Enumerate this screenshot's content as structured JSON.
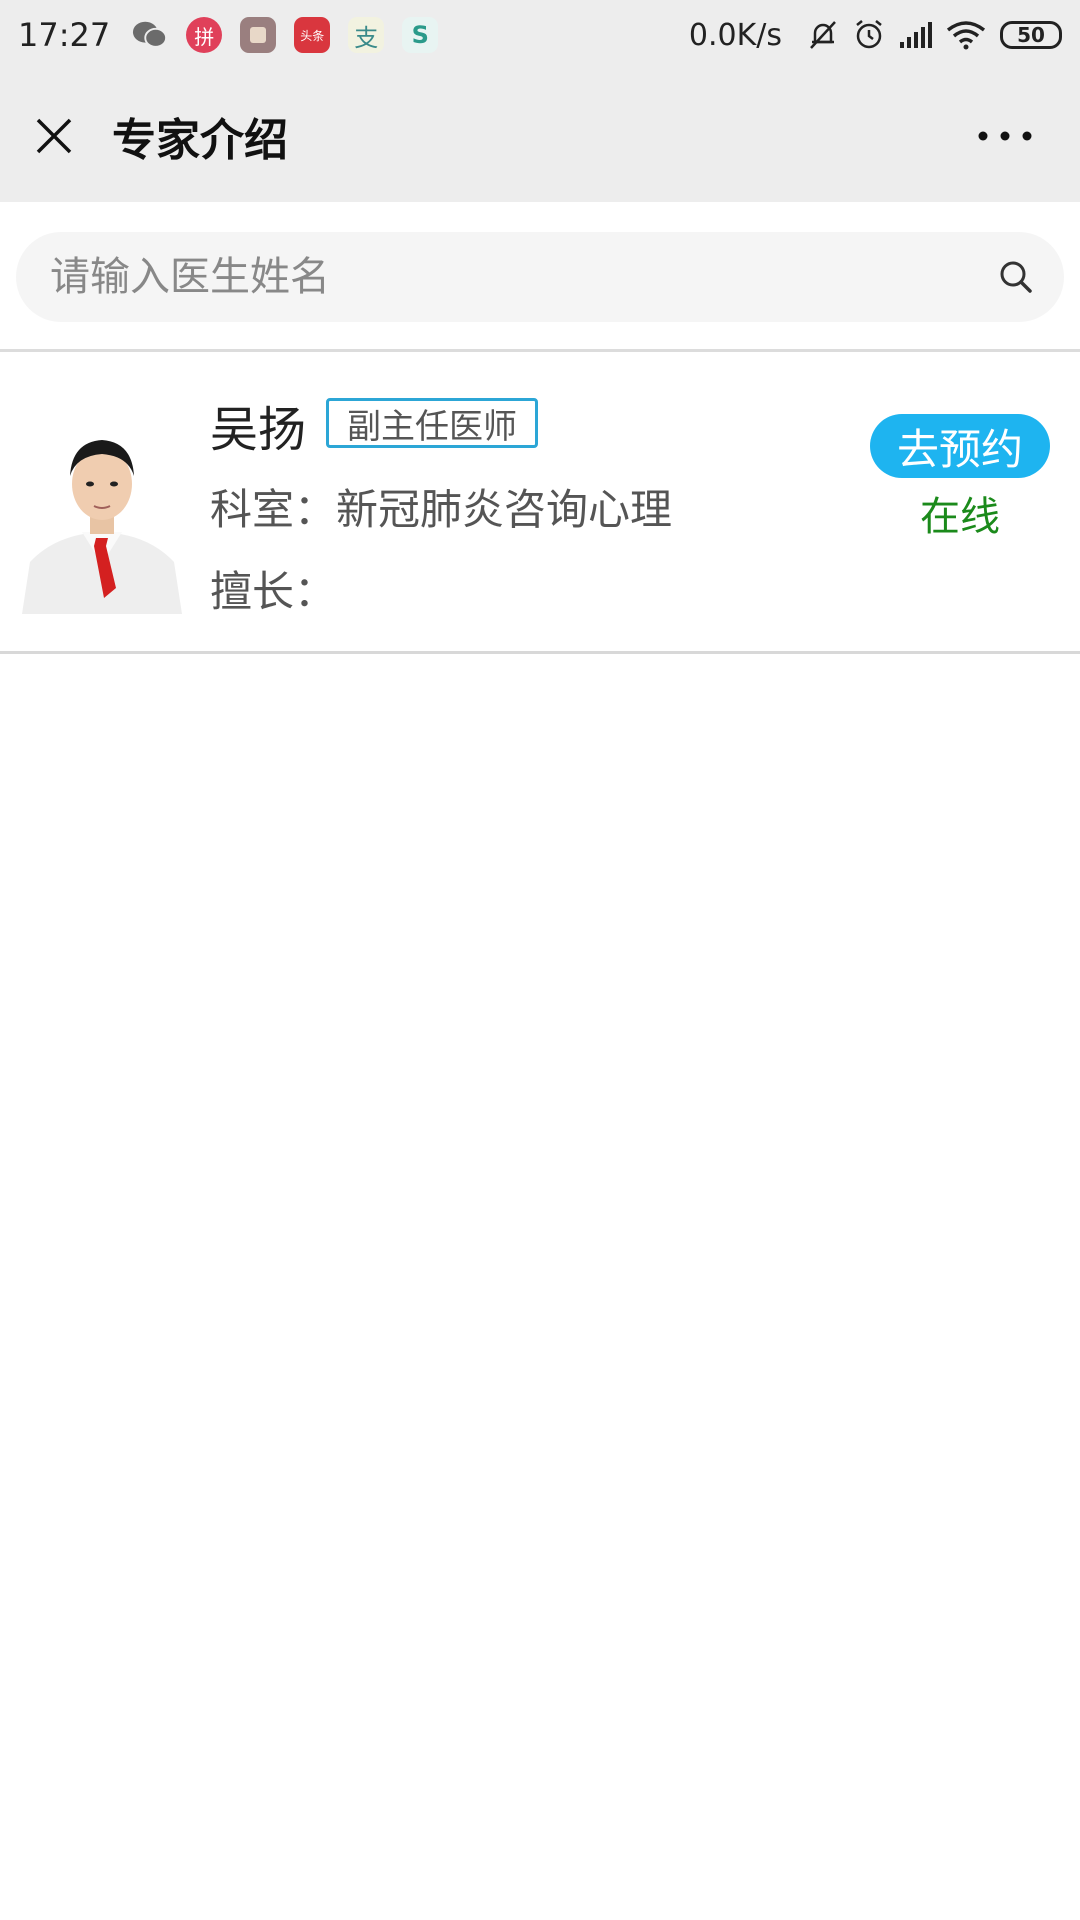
{
  "status_bar": {
    "time": "17:27",
    "net_speed": "0.0K/s",
    "battery": "50",
    "app_icons": [
      {
        "name": "wechat-icon",
        "color": "#6b6b6b",
        "glyph": ""
      },
      {
        "name": "pinduoduo-icon",
        "color": "#e0405a",
        "glyph": "拼"
      },
      {
        "name": "gallery-app-icon",
        "color": "#9a7f7f",
        "glyph": ""
      },
      {
        "name": "toutiao-icon",
        "color": "#d9363e",
        "glyph": "头条"
      },
      {
        "name": "alipay-icon",
        "color": "#f2f2e0",
        "glyph": "支"
      },
      {
        "name": "app-s-icon",
        "color": "#e8f4f2",
        "glyph": "S"
      }
    ]
  },
  "nav": {
    "title": "专家介绍"
  },
  "search": {
    "placeholder": "请输入医生姓名"
  },
  "doctor": {
    "name": "吴扬",
    "title": "副主任医师",
    "department": "科室：新冠肺炎咨询心理",
    "specialty": "擅长：",
    "book_label": "去预约",
    "status": "在线"
  },
  "colors": {
    "accent": "#1eb4f0",
    "badge_border": "#2ca6d6",
    "online": "#1b8a1b",
    "nav_bg": "#ededed"
  }
}
